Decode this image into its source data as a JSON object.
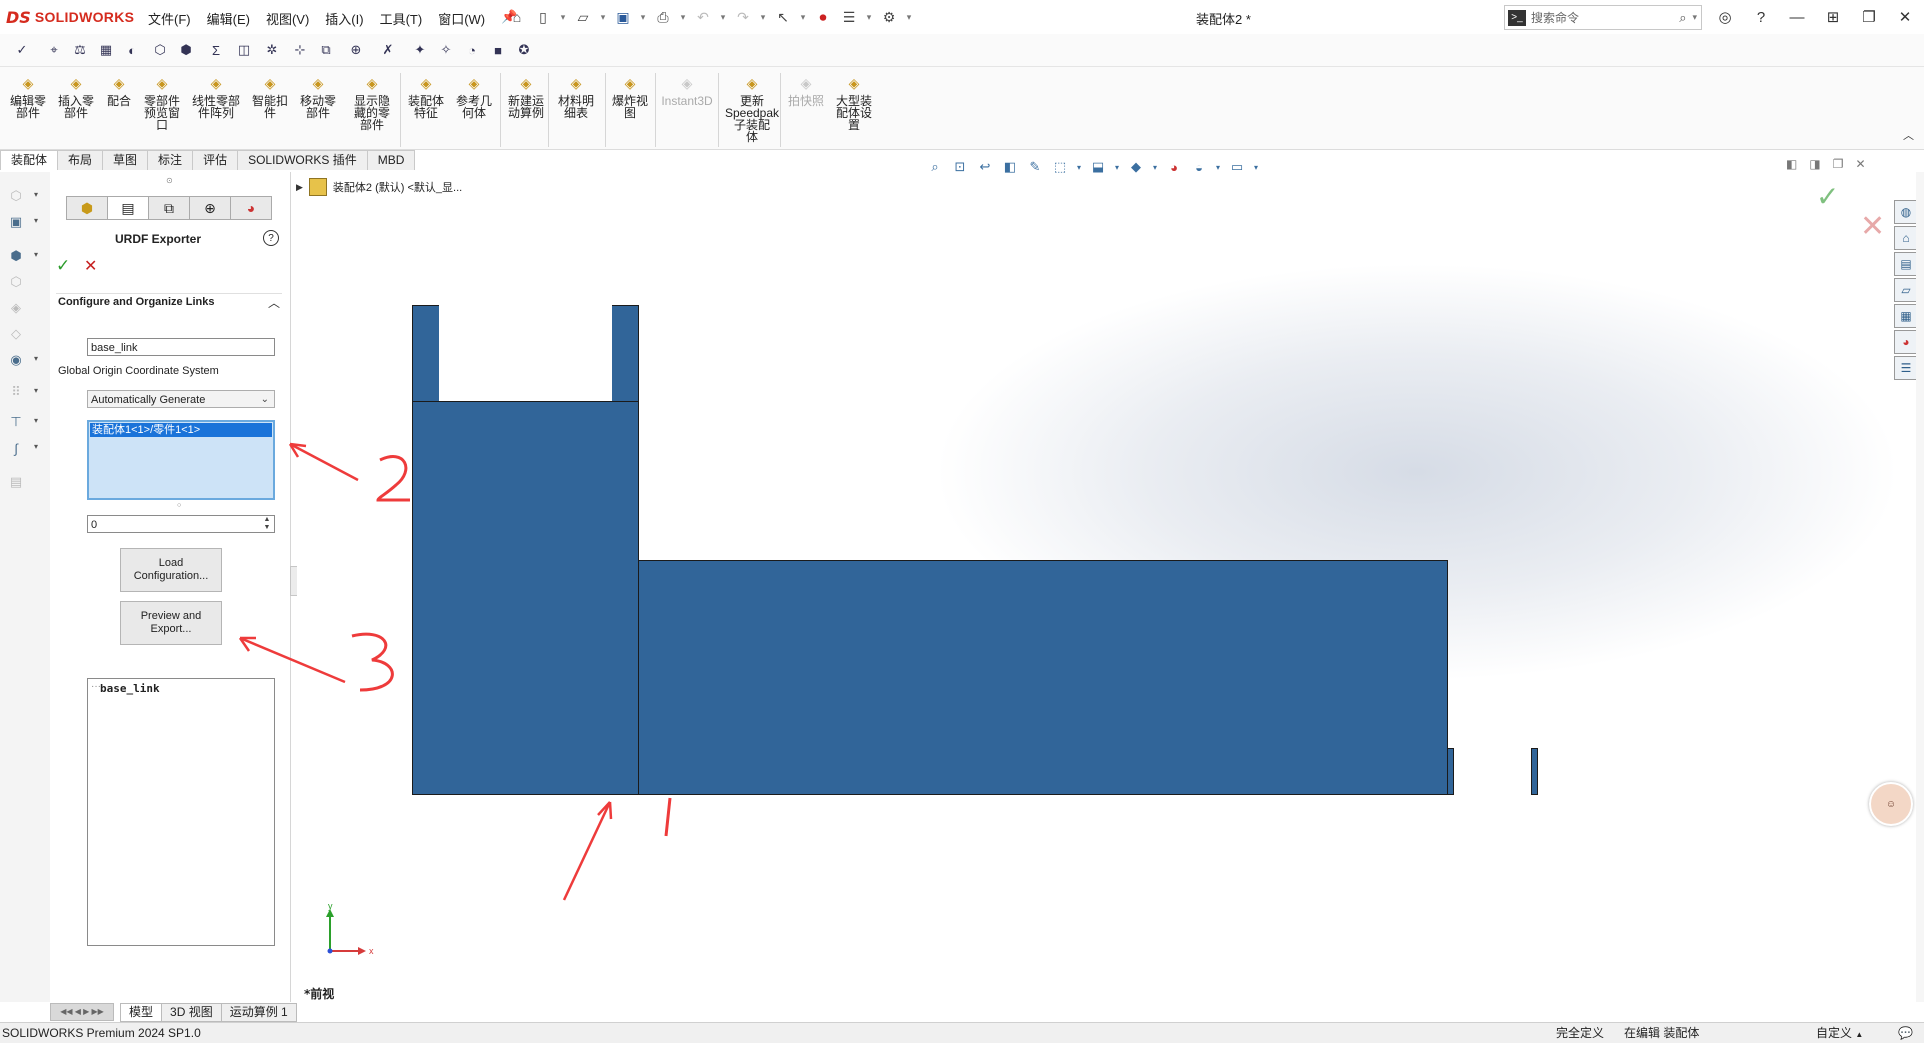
{
  "app": {
    "logo_mark": "DS",
    "logo_text": "SOLIDWORKS",
    "document_title": "装配体2 *",
    "menus": [
      "文件(F)",
      "编辑(E)",
      "视图(V)",
      "插入(I)",
      "工具(T)",
      "窗口(W)"
    ],
    "search_placeholder": "搜索命令"
  },
  "command_manager": {
    "buttons": [
      {
        "label": "编辑零\n部件",
        "icon": "edit-component-icon"
      },
      {
        "label": "插入零\n部件",
        "icon": "insert-component-icon"
      },
      {
        "label": "配合",
        "icon": "mate-icon"
      },
      {
        "label": "零部件\n预览窗\n口",
        "icon": "component-preview-icon"
      },
      {
        "label": "线性零部\n件阵列",
        "icon": "linear-pattern-icon"
      },
      {
        "label": "智能扣\n件",
        "icon": "smart-fastener-icon"
      },
      {
        "label": "移动零\n部件",
        "icon": "move-component-icon"
      },
      {
        "label": "显示隐\n藏的零\n部件",
        "icon": "show-hidden-icon"
      },
      {
        "label": "装配体\n特征",
        "icon": "assembly-feature-icon"
      },
      {
        "label": "参考几\n何体",
        "icon": "reference-geometry-icon"
      },
      {
        "label": "新建运\n动算例",
        "icon": "motion-study-icon"
      },
      {
        "label": "材料明\n细表",
        "icon": "bom-icon"
      },
      {
        "label": "爆炸视\n图",
        "icon": "exploded-view-icon"
      },
      {
        "label": "Instant3D",
        "icon": "instant3d-icon"
      },
      {
        "label": "更新\nSpeedpak\n子装配\n体",
        "icon": "speedpak-icon"
      },
      {
        "label": "拍快照",
        "icon": "snapshot-icon"
      },
      {
        "label": "大型装\n配体设\n置",
        "icon": "large-assembly-icon"
      }
    ]
  },
  "tabs": [
    "装配体",
    "布局",
    "草图",
    "标注",
    "评估",
    "SOLIDWORKS 插件",
    "MBD"
  ],
  "feature_tree": {
    "root_label": "装配体2 (默认) <默认_显..."
  },
  "property_manager": {
    "title": "URDF Exporter",
    "help": "?",
    "ok": "✓",
    "cancel": "✕",
    "section_title": "Configure and Organize Links",
    "link_name": "base_link",
    "coord_label": "Global Origin Coordinate System",
    "coord_value": "Automatically Generate",
    "selected_components": [
      "装配体1<1>/零件1<1>"
    ],
    "number_value": "0",
    "load_button": "Load\nConfiguration...",
    "export_button": "Preview and\nExport...",
    "tree_root": "base_link"
  },
  "graphics": {
    "part_color": "#316599",
    "view_name": "*前视",
    "triad_x": "x",
    "triad_y": "y"
  },
  "bottom_tabs": [
    "模型",
    "3D 视图",
    "运动算例 1"
  ],
  "status": {
    "product": "SOLIDWORKS Premium 2024 SP1.0",
    "state1": "完全定义",
    "state2": "在编辑 装配体",
    "units": "自定义",
    "units_caret": "▲"
  },
  "annotations": {
    "color": "#ee3b3b",
    "numbers": [
      "1",
      "2",
      "3"
    ]
  }
}
